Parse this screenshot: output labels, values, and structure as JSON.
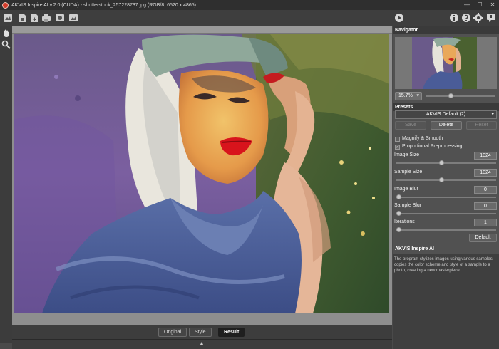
{
  "window": {
    "title": "AKVIS Inspire AI v.2.0 (CUDA) - shutterstock_257228737.jpg (RGB/8, 6520 x 4865)",
    "minimize": "—",
    "maximize": "☐",
    "close": "✕"
  },
  "toolbar": {
    "left_icons": [
      "open-icon",
      "save-icon",
      "export-icon",
      "print-icon",
      "batch-icon",
      "preferences-icon"
    ],
    "right_icons": [
      "run-icon",
      "info-icon",
      "help-icon",
      "settings-icon",
      "notifications-icon"
    ]
  },
  "tools": [
    "hand-icon",
    "zoom-icon"
  ],
  "view_tabs": [
    {
      "label": "Original",
      "active": false
    },
    {
      "label": "Style",
      "active": false
    },
    {
      "label": "Result",
      "active": true
    }
  ],
  "navigator": {
    "title": "Navigator",
    "zoom": "15.7%",
    "zoom_level": 0.35
  },
  "presets": {
    "title": "Presets",
    "selected": "AKVIS Default (2)",
    "save": "Save",
    "delete": "Delete",
    "reset": "Reset"
  },
  "settings": {
    "magnify_smooth": {
      "label": "Magnify & Smooth",
      "checked": false
    },
    "proportional_preprocessing": {
      "label": "Proportional Preprocessing",
      "checked": true
    },
    "image_size": {
      "label": "Image Size",
      "value": "1024",
      "fraction": 0.45
    },
    "sample_size": {
      "label": "Sample Size",
      "value": "1024",
      "fraction": 0.45
    },
    "image_blur": {
      "label": "Image Blur",
      "value": "0",
      "fraction": 0.0
    },
    "sample_blur": {
      "label": "Sample Blur",
      "value": "0",
      "fraction": 0.0
    },
    "iterations": {
      "label": "Iterations",
      "value": "1",
      "fraction": 0.0
    },
    "default_button": "Default"
  },
  "about": {
    "title": "AKVIS Inspire AI",
    "description": "The program stylizes images using various samples, copies the color scheme and style of a sample to a photo, creating a new masterpiece."
  },
  "colors": {
    "panel_bg": "#515151",
    "header_bg": "#3a3a3a",
    "active_tab": "#1f1f1f"
  }
}
